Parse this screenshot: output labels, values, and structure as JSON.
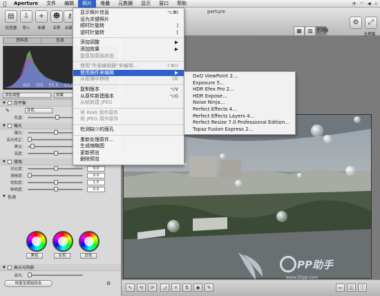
{
  "menubar": {
    "apple": "",
    "items": [
      "Aperture",
      "文件",
      "编辑",
      "照片",
      "堆叠",
      "元数据",
      "显示",
      "窗口",
      "帮助"
    ],
    "active_index": 3
  },
  "toolbar": {
    "buttons": [
      "检查器",
      "导入",
      "新建",
      "名称",
      "关键"
    ],
    "window_title": "perture",
    "viewer_label": "检视器",
    "fullscreen_label": "全屏幕"
  },
  "left": {
    "tabs": [
      "资料库",
      "信息",
      "调整"
    ],
    "exif": [
      "ISO 100",
      "f/5.6",
      "1/12"
    ],
    "preset_select": "添加调整",
    "effect_select": "效果",
    "sections": {
      "white_balance": "白平衡",
      "gray_select": "灰色",
      "tint_label": "色温：",
      "exposure": "曝光",
      "enhance": "增强",
      "color_label": "色调",
      "highlights_shadows": "高光与阴影"
    },
    "sliders_exposure": [
      "曝光：",
      "高光修正：",
      "黑点：",
      "亮度："
    ],
    "sliders_enhance": [
      {
        "name": "对比度：",
        "value": "0.0"
      },
      {
        "name": "清晰度：",
        "value": "0.0"
      },
      {
        "name": "饱和度：",
        "value": "1.0"
      },
      {
        "name": "鲜明度：",
        "value": "0.0"
      }
    ],
    "wheel_labels": [
      "黑色",
      "灰色",
      "白色"
    ],
    "hs_slider": "高光：",
    "restore_button": "恢复至原始状态"
  },
  "menu": {
    "items": [
      {
        "label": "显示照片信息",
        "shortcut": "⌥⌘I",
        "disabled": false,
        "arrow": false
      },
      {
        "label": "设为关键照片",
        "shortcut": "",
        "disabled": false,
        "arrow": false
      },
      {
        "label": "顺时针旋转",
        "shortcut": "]",
        "disabled": false,
        "arrow": false
      },
      {
        "label": "逆时针旋转",
        "shortcut": "[",
        "disabled": false,
        "arrow": false
      },
      {
        "sep": true
      },
      {
        "label": "添加调整",
        "shortcut": "",
        "disabled": false,
        "arrow": true
      },
      {
        "label": "添加效果",
        "shortcut": "",
        "disabled": false,
        "arrow": true
      },
      {
        "label": "复原到原始状态",
        "shortcut": "",
        "disabled": true,
        "arrow": false
      },
      {
        "sep": true
      },
      {
        "label": "使用\"外部编辑器\"来编辑…",
        "shortcut": "⇧⌘O",
        "disabled": true,
        "arrow": false
      },
      {
        "label": "使用插件来编辑",
        "shortcut": "",
        "disabled": false,
        "arrow": true,
        "highlight": true
      },
      {
        "label": "从相簿中移除",
        "shortcut": "⌫",
        "disabled": true,
        "arrow": false
      },
      {
        "sep": true
      },
      {
        "label": "复制版本",
        "shortcut": "⌥V",
        "disabled": false,
        "arrow": false
      },
      {
        "label": "从原件新建版本",
        "shortcut": "⌥G",
        "disabled": false,
        "arrow": false
      },
      {
        "label": "从帧新建 JPEG",
        "shortcut": "",
        "disabled": true,
        "arrow": false
      },
      {
        "sep": true
      },
      {
        "label": "将 RAW 用作原件",
        "shortcut": "",
        "disabled": true,
        "arrow": false
      },
      {
        "label": "将 JPEG 用作原件",
        "shortcut": "",
        "disabled": true,
        "arrow": false
      },
      {
        "sep": true
      },
      {
        "label": "检测缺少的面孔",
        "shortcut": "",
        "disabled": false,
        "arrow": false
      },
      {
        "sep": true
      },
      {
        "label": "重新处理原件…",
        "shortcut": "",
        "disabled": false,
        "arrow": false
      },
      {
        "label": "生成缩略图",
        "shortcut": "",
        "disabled": false,
        "arrow": false
      },
      {
        "label": "更新预览",
        "shortcut": "",
        "disabled": false,
        "arrow": false
      },
      {
        "label": "删除预览",
        "shortcut": "",
        "disabled": false,
        "arrow": false
      }
    ]
  },
  "submenu": {
    "items": [
      "DxO ViewPoint 2…",
      "Exposure 5…",
      "HDR Efex Pro 2…",
      "HDR Expose…",
      "Noise Ninja…",
      "Perfect Effects 4…",
      "Perfect Effects Layers 4…",
      "Perfect Resize 7.0 Professional Edition…",
      "Topaz Fusion Express 2…"
    ]
  },
  "watermark": {
    "text": "PP助手",
    "url": "www.25pp.com"
  }
}
